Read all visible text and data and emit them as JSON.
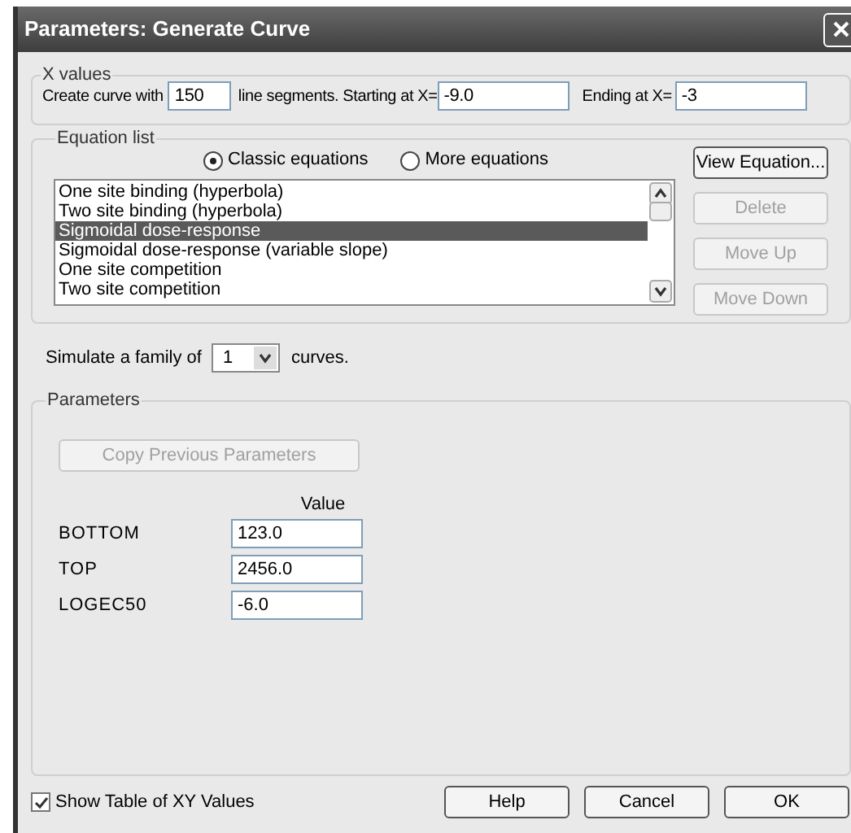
{
  "window": {
    "title": "Parameters: Generate Curve"
  },
  "x_values": {
    "legend": "X values",
    "create_label": "Create curve with",
    "segments": "150",
    "segments_label": "line segments. Starting at X=",
    "start": "-9.0",
    "end_label": "Ending at X=",
    "end": "-3"
  },
  "equation_list": {
    "legend": "Equation list",
    "radios": [
      {
        "label": "Classic equations",
        "selected": true
      },
      {
        "label": "More equations",
        "selected": false
      }
    ],
    "items": [
      {
        "label": "One site binding (hyperbola)",
        "selected": false
      },
      {
        "label": "Two site binding (hyperbola)",
        "selected": false
      },
      {
        "label": "Sigmoidal dose-response",
        "selected": true
      },
      {
        "label": "Sigmoidal dose-response (variable slope)",
        "selected": false
      },
      {
        "label": "One site competition",
        "selected": false
      },
      {
        "label": "Two site competition",
        "selected": false
      }
    ],
    "buttons": [
      {
        "label": "View Equation...",
        "disabled": false
      },
      {
        "label": "Delete",
        "disabled": true
      },
      {
        "label": "Move Up",
        "disabled": true
      },
      {
        "label": "Move Down",
        "disabled": true
      }
    ]
  },
  "simulate": {
    "label": "Simulate a family of",
    "value": "1",
    "suffix": "curves."
  },
  "parameters": {
    "legend": "Parameters",
    "copy_button": {
      "label": "Copy Previous Parameters",
      "disabled": true
    },
    "value_header": "Value",
    "rows": [
      {
        "name": "BOTTOM",
        "value": "123.0"
      },
      {
        "name": "TOP",
        "value": "2456.0"
      },
      {
        "name": "LOGEC50",
        "value": "-6.0"
      }
    ]
  },
  "show_table": {
    "label": "Show Table of XY Values",
    "checked": true
  },
  "buttons": [
    {
      "label": "Help"
    },
    {
      "label": "Cancel"
    },
    {
      "label": "OK"
    }
  ]
}
